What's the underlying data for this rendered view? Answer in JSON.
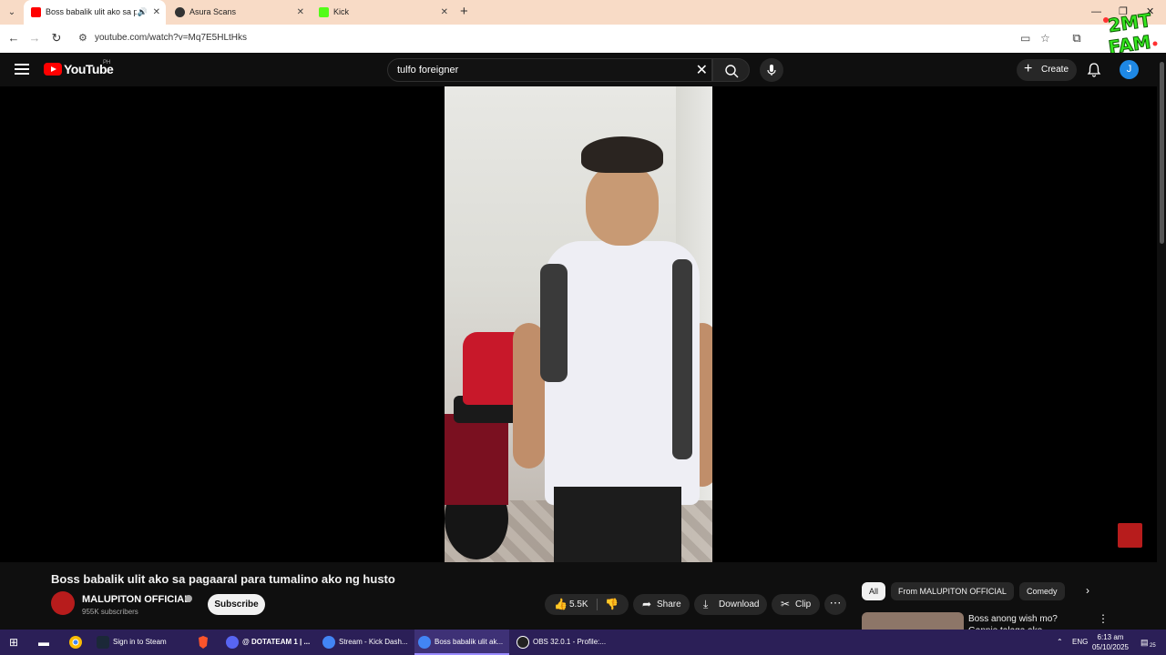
{
  "browser": {
    "tabs": [
      {
        "title": "Boss babalik ulit ako sa pag",
        "favicon_color": "#ff0000",
        "active": true
      },
      {
        "title": "Asura Scans",
        "favicon_color": "#333333",
        "active": false
      },
      {
        "title": "Kick",
        "favicon_color": "#53fc18",
        "active": false
      }
    ],
    "new_tab": "+",
    "window_controls": {
      "minimize": "—",
      "maximize": "❐",
      "close": "✕"
    },
    "url": "youtube.com/watch?v=Mq7E5HLtHks"
  },
  "overlay_logo": {
    "text": "2MT FAM",
    "color": "#35e81f"
  },
  "youtube": {
    "wordmark": "YouTube",
    "country": "PH",
    "search_value": "tulfo foreigner",
    "create_label": "Create",
    "avatar_letter": "J",
    "video": {
      "title": "Boss babalik ulit ako sa pagaaral para tumalino ako ng husto",
      "channel_name": "MALUPITON OFFICIAL",
      "subscribers": "955K subscribers",
      "subscribe_label": "Subscribe",
      "likes": "5.5K",
      "share_label": "Share",
      "download_label": "Download",
      "clip_label": "Clip"
    },
    "chips": [
      "All",
      "From MALUPITON OFFICIAL",
      "Comedy"
    ],
    "recommendation": {
      "title": "Boss anong wish mo? Gannie talaga ako"
    }
  },
  "taskbar": {
    "items": [
      {
        "label": "Sign in to Steam",
        "icon_color": "#1b2838"
      },
      {
        "label": "@ DOTATEAM 1 | ...",
        "icon_color": "#5865f2"
      },
      {
        "label": "Stream - Kick Dash...",
        "icon_color": "#4285f4"
      },
      {
        "label": "Boss babalik ulit ak...",
        "icon_color": "#4285f4"
      },
      {
        "label": "OBS 32.0.1 - Profile:...",
        "icon_color": "#222222"
      }
    ],
    "lang": "ENG",
    "time": "6:13 am",
    "date": "05/10/2025",
    "notifications": "25"
  }
}
